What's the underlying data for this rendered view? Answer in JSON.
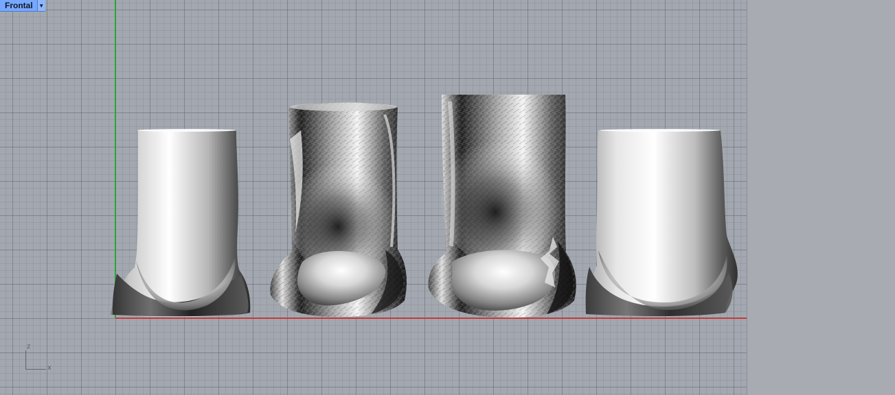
{
  "viewport": {
    "tab_label": "Frontal",
    "menu_icon": "triangle-down-icon"
  },
  "axis_triad": {
    "z_label": "z",
    "x_label": "x"
  },
  "colors": {
    "viewport_background": "#a3a8b0",
    "grid_minor": "#828890",
    "grid_major": "#5c626a",
    "z_axis": "#2aa33f",
    "x_axis": "#c63a3a",
    "tab_active": "#77a8ff"
  },
  "objects": [
    {
      "name": "rendered-solid-smooth-left",
      "style": "smooth shaded"
    },
    {
      "name": "rendered-solid-scan-left",
      "style": "faceted shaded"
    },
    {
      "name": "rendered-solid-scan-right",
      "style": "faceted shaded"
    },
    {
      "name": "rendered-solid-smooth-right",
      "style": "smooth shaded"
    }
  ]
}
